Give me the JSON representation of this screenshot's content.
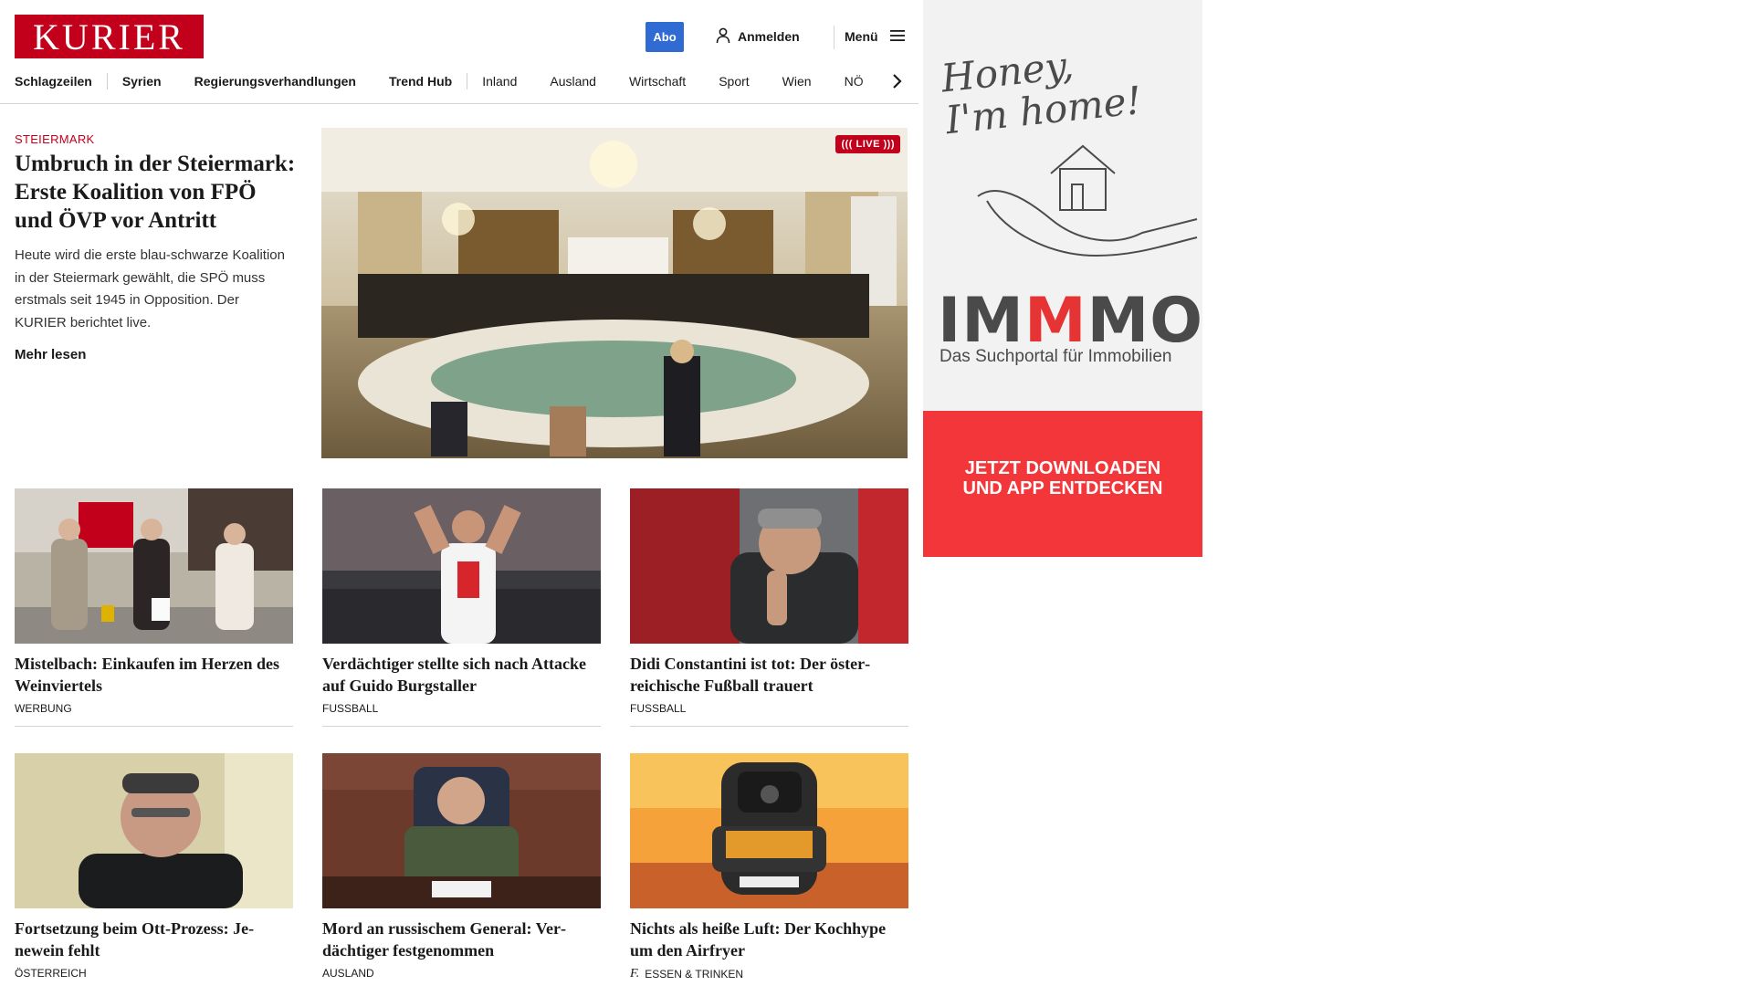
{
  "header": {
    "logo": "KURIER",
    "abo_label": "Abo",
    "login_label": "Anmelden",
    "menu_label": "Menü"
  },
  "nav": {
    "items": [
      "Schlagzeilen",
      "Syrien",
      "Regierungsverhandlungen",
      "Trend Hub",
      "Inland",
      "Ausland",
      "Wirtschaft",
      "Sport",
      "Wien",
      "NÖ"
    ]
  },
  "hero": {
    "kicker": "STEIERMARK",
    "title": "Umbruch in der Steier­mark: Erste Koalition von FPÖ und ÖVP vor Antritt",
    "teaser": "Heute wird die erste blau-schwarze Koalition in der Steiermark gewählt, die SPÖ muss erstmals seit 1945 in Opposition. Der KURIER berichtet live.",
    "more": "Mehr lesen",
    "live_badge": "((( LIVE )))"
  },
  "cards": [
    {
      "title": "Mistelbach: Einkaufen im Herzen des Weinviertels",
      "category": "WERBUNG"
    },
    {
      "title": "Verdächtiger stellte sich nach Atta­cke auf Guido Burgstaller",
      "category": "FUSSBALL"
    },
    {
      "title": "Didi Constantini ist tot: Der öster­reichische Fußball trauert",
      "category": "FUSSBALL"
    },
    {
      "title": "Fortsetzung beim Ott-Prozess: Je­newein fehlt",
      "category": "ÖSTERREICH"
    },
    {
      "title": "Mord an russischem General: Ver­dächtiger festgenommen",
      "category": "AUSLAND"
    },
    {
      "title": "Nichts als heiße Luft: Der Koch­hype um den Airfryer",
      "category": "ESSEN & TRINKEN",
      "category_icon": "f."
    }
  ],
  "ad": {
    "script": "Honey, I'm home!",
    "logo_parts": [
      "IM",
      "M",
      "MO"
    ],
    "subtitle": "Das Suchportal für Immobilien",
    "cta_line1": "JETZT DOWNLOADEN",
    "cta_line2": "UND APP ENTDECKEN"
  },
  "colors": {
    "brand": "#c3001b",
    "abo": "#2f6bd2",
    "ad_red": "#f2363a"
  }
}
